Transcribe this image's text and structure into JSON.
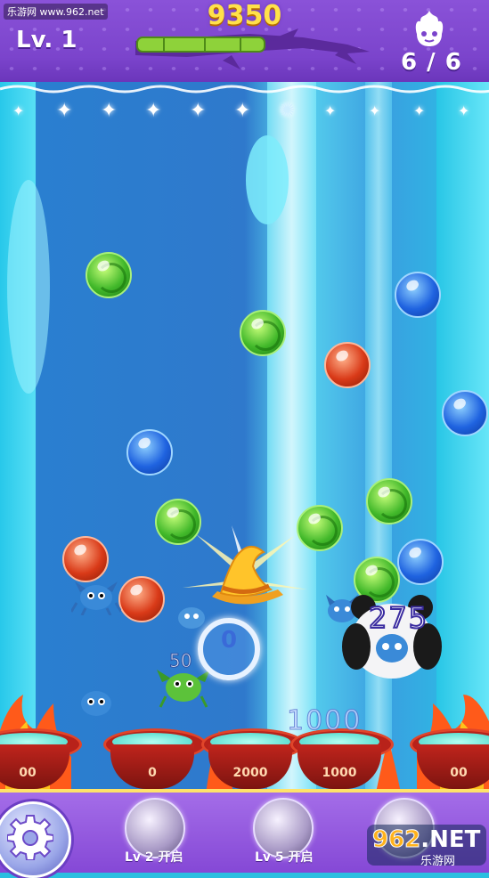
{
  "watermark": "乐游网 www.962.net",
  "hud": {
    "level_label": "Lv. 1",
    "score": "9350",
    "lives": "6 / 6",
    "progress_fraction": 0.55
  },
  "playfield": {
    "floating_scores": {
      "big": "1000",
      "panda": "275",
      "small": "50",
      "combo": "0"
    },
    "cauldron_values": [
      "00",
      "0",
      "2000",
      "1000",
      "00"
    ]
  },
  "powerups": [
    {
      "label": "Lv 2 开启"
    },
    {
      "label": "Lv 5 开启"
    }
  ],
  "site_badge": {
    "logo_prefix": "962",
    "logo_suffix": ".NET",
    "subtitle": "乐游网"
  },
  "colors": {
    "hud_purple": "#7b44cc",
    "score_gold": "#ffe14a",
    "bubble_green": "#41b82a",
    "bubble_blue": "#1f63e0",
    "bubble_red": "#d93a18"
  },
  "icons": [
    "gear-icon",
    "flame-head-icon",
    "star-icon",
    "branch-progress-icon",
    "witch-hat-icon"
  ]
}
